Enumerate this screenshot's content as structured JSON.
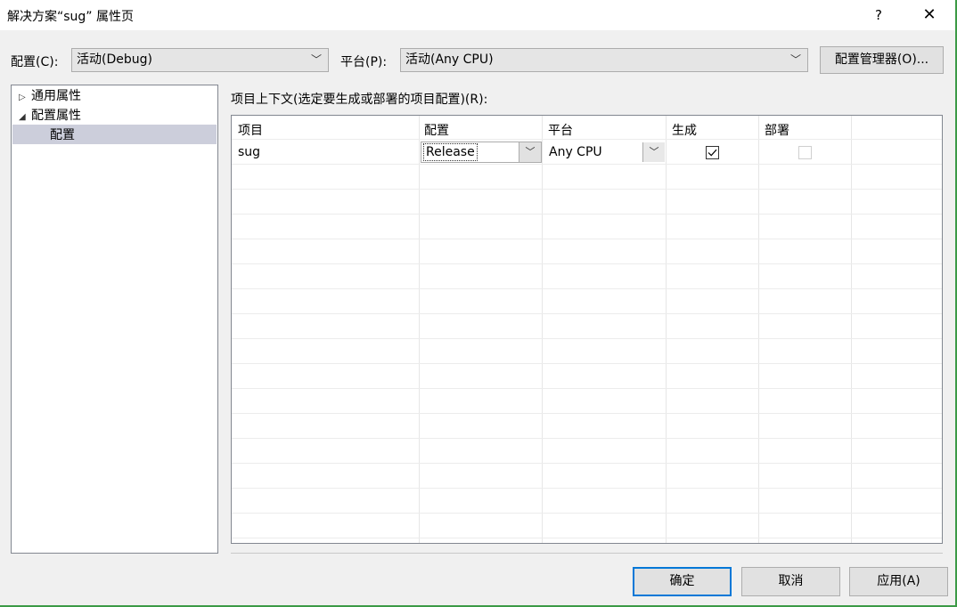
{
  "window": {
    "title": "解决方案“sug” 属性页",
    "help_glyph": "?",
    "close_glyph": "✕"
  },
  "toolbar": {
    "config_label": "配置(C):",
    "config_value": "活动(Debug)",
    "platform_label": "平台(P):",
    "platform_value": "活动(Any CPU)",
    "config_manager_label": "配置管理器(O)..."
  },
  "tree": {
    "items": [
      {
        "label": "通用属性",
        "expander": "▷"
      },
      {
        "label": "配置属性",
        "expander": "◢"
      },
      {
        "label": "配置",
        "expander": ""
      }
    ],
    "selected_index": 2
  },
  "grid": {
    "caption": "项目上下文(选定要生成或部署的项目配置)(R):",
    "headers": [
      "项目",
      "配置",
      "平台",
      "生成",
      "部署"
    ],
    "rows": [
      {
        "project": "sug",
        "configuration": "Release",
        "platform": "Any CPU",
        "build": true,
        "deploy": false
      }
    ]
  },
  "buttons": {
    "ok": "确定",
    "cancel": "取消",
    "apply": "应用(A)"
  },
  "icons": {
    "dropdown": "chevron-down-icon",
    "check": "checkmark-icon"
  }
}
